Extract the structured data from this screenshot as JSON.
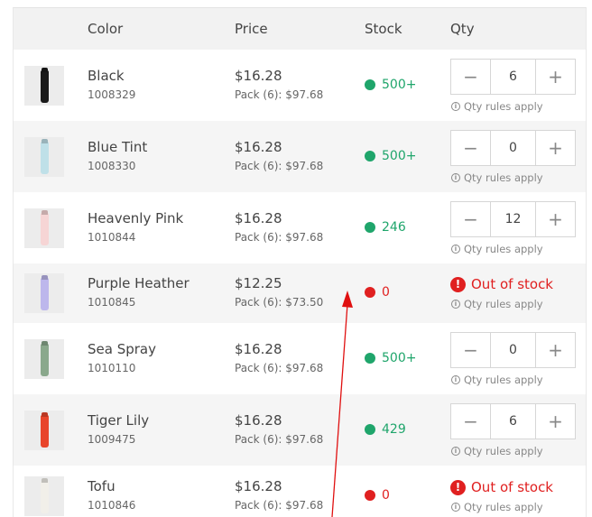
{
  "header": {
    "color": "Color",
    "price": "Price",
    "stock": "Stock",
    "qty": "Qty"
  },
  "labels": {
    "qty_rules": "Qty rules apply",
    "out_of_stock": "Out of stock",
    "minus": "−",
    "plus": "+",
    "info": "i",
    "alert": "!"
  },
  "colors": {
    "in_stock": "#1fa56b",
    "out_of_stock": "#e02020",
    "row_alt": "#f5f5f5"
  },
  "rows": [
    {
      "name": "Black",
      "sku": "1008329",
      "price": "$16.28",
      "pack": "Pack (6): $97.68",
      "stock": "500+",
      "in_stock": true,
      "qty": "6",
      "bottle_color": "#1a1a1a"
    },
    {
      "name": "Blue Tint",
      "sku": "1008330",
      "price": "$16.28",
      "pack": "Pack (6): $97.68",
      "stock": "500+",
      "in_stock": true,
      "qty": "0",
      "bottle_color": "#bfe0e8"
    },
    {
      "name": "Heavenly Pink",
      "sku": "1010844",
      "price": "$16.28",
      "pack": "Pack (6): $97.68",
      "stock": "246",
      "in_stock": true,
      "qty": "12",
      "bottle_color": "#f6d5d5"
    },
    {
      "name": "Purple Heather",
      "sku": "1010845",
      "price": "$12.25",
      "pack": "Pack (6): $73.50",
      "stock": "0",
      "in_stock": false,
      "qty": "",
      "bottle_color": "#bdb7ec"
    },
    {
      "name": "Sea Spray",
      "sku": "1010110",
      "price": "$16.28",
      "pack": "Pack (6): $97.68",
      "stock": "500+",
      "in_stock": true,
      "qty": "0",
      "bottle_color": "#8aa88c"
    },
    {
      "name": "Tiger Lily",
      "sku": "1009475",
      "price": "$16.28",
      "pack": "Pack (6): $97.68",
      "stock": "429",
      "in_stock": true,
      "qty": "6",
      "bottle_color": "#e8452b"
    },
    {
      "name": "Tofu",
      "sku": "1010846",
      "price": "$16.28",
      "pack": "Pack (6): $97.68",
      "stock": "0",
      "in_stock": false,
      "qty": "",
      "bottle_color": "#f1efe9"
    }
  ]
}
